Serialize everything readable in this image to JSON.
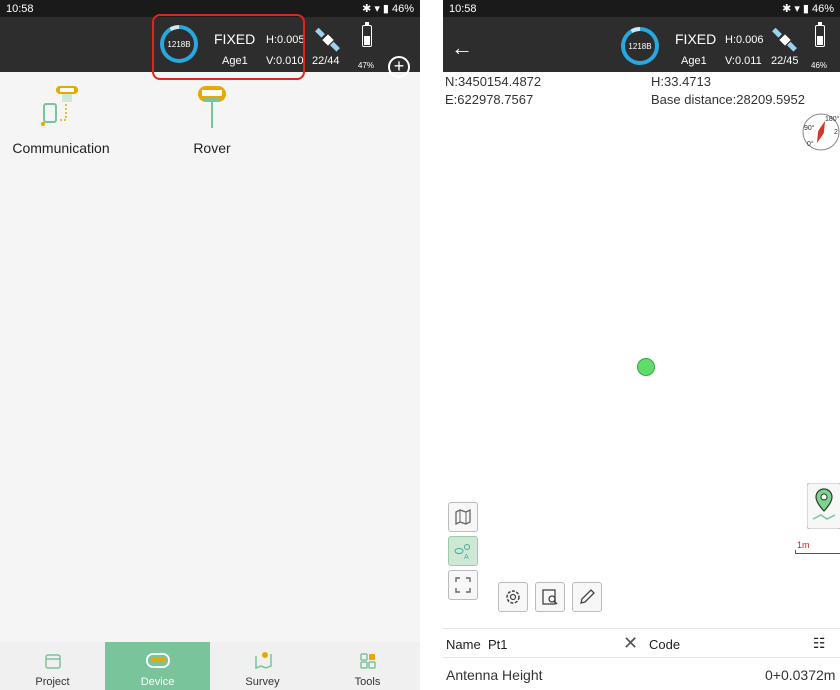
{
  "left": {
    "status": {
      "time": "10:58",
      "battery": "46%"
    },
    "gnss": {
      "ring_label": "1218B",
      "fix": "FIXED",
      "age": "Age1",
      "h": "H:0.005",
      "v": "V:0.010",
      "sats": "22/44",
      "battery": "47%"
    },
    "tiles": [
      {
        "label": "Communication"
      },
      {
        "label": "Rover"
      }
    ],
    "nav": [
      {
        "label": "Project",
        "icon": "folder-icon"
      },
      {
        "label": "Device",
        "icon": "receiver-icon",
        "active": true
      },
      {
        "label": "Survey",
        "icon": "map-pin-icon"
      },
      {
        "label": "Tools",
        "icon": "grid-icon"
      }
    ]
  },
  "right": {
    "status": {
      "time": "10:58",
      "battery": "46%"
    },
    "gnss": {
      "ring_label": "1218B",
      "fix": "FIXED",
      "age": "Age1",
      "h": "H:0.006",
      "v": "V:0.011",
      "sats": "22/45",
      "battery": "46%"
    },
    "coords": {
      "n": "N:3450154.4872",
      "e": "E:622978.7567",
      "h": "H:33.4713",
      "base": "Base distance:28209.5952"
    },
    "compass": {
      "n": "180°",
      "w": "90°",
      "s": "0°",
      "e": "2"
    },
    "scale": "1m",
    "name_label": "Name",
    "name_value": "Pt1",
    "code_label": "Code",
    "antenna_label": "Antenna Height",
    "antenna_value": "0+0.0372m"
  }
}
